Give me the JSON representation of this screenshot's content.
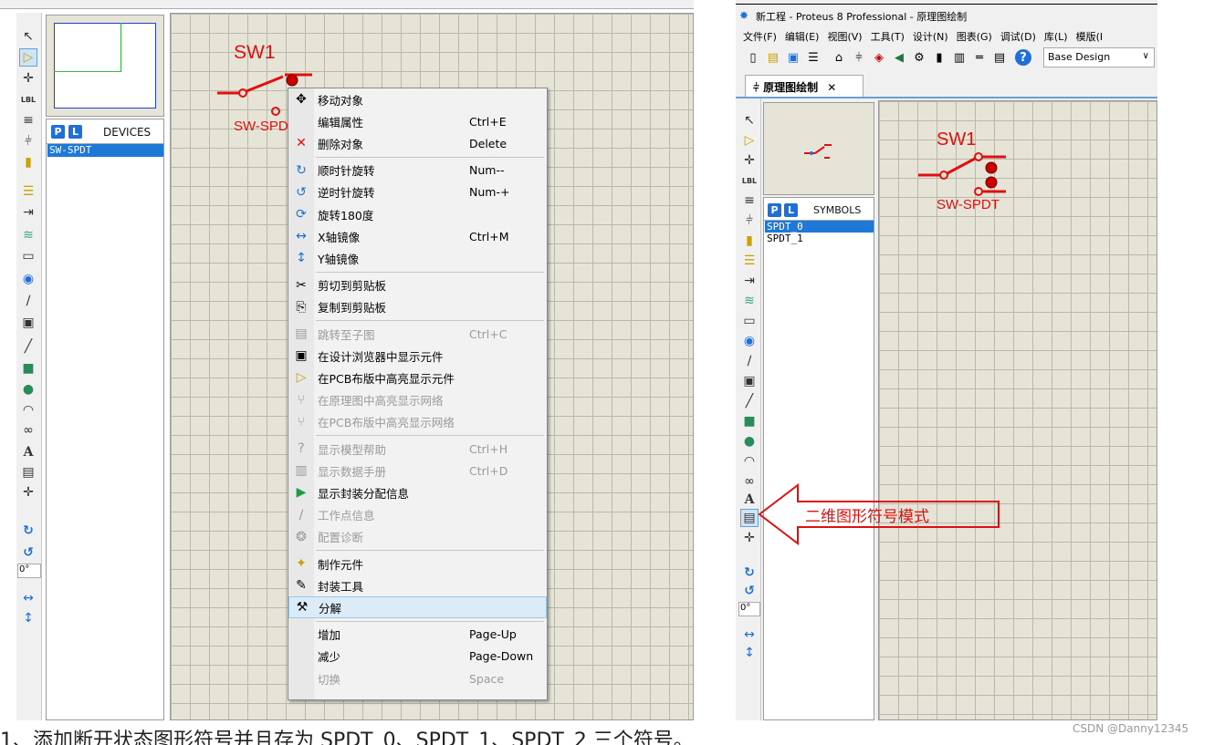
{
  "left": {
    "panel_header": "DEVICES",
    "device_selected": "SW-SPDT",
    "rotation_field": "0°",
    "component_label": "SW1",
    "component_ref": "SW-SPDT"
  },
  "context_menu": {
    "items": [
      {
        "label": "移动对象",
        "shortcut": "",
        "icon": "move-icon"
      },
      {
        "label": "编辑属性",
        "shortcut": "Ctrl+E",
        "icon": ""
      },
      {
        "label": "删除对象",
        "shortcut": "Delete",
        "icon": "delete-icon"
      },
      {
        "label": "顺时针旋转",
        "shortcut": "Num--",
        "icon": "rotate-cw-icon"
      },
      {
        "label": "逆时针旋转",
        "shortcut": "Num-+",
        "icon": "rotate-ccw-icon"
      },
      {
        "label": "旋转180度",
        "shortcut": "",
        "icon": "rotate-180-icon"
      },
      {
        "label": "X轴镜像",
        "shortcut": "Ctrl+M",
        "icon": "mirror-x-icon"
      },
      {
        "label": "Y轴镜像",
        "shortcut": "",
        "icon": "mirror-y-icon"
      },
      {
        "label": "剪切到剪贴板",
        "shortcut": "",
        "icon": "cut-icon"
      },
      {
        "label": "复制到剪贴板",
        "shortcut": "",
        "icon": "copy-icon"
      },
      {
        "label": "跳转至子图",
        "shortcut": "Ctrl+C",
        "icon": "subsheet-icon",
        "disabled": true
      },
      {
        "label": "在设计浏览器中显示元件",
        "shortcut": "",
        "icon": "browser-icon"
      },
      {
        "label": "在PCB布版中高亮显示元件",
        "shortcut": "",
        "icon": "pcb-highlight-icon"
      },
      {
        "label": "在原理图中高亮显示网络",
        "shortcut": "",
        "icon": "net-icon",
        "disabled": true
      },
      {
        "label": "在PCB布版中高亮显示网络",
        "shortcut": "",
        "icon": "pcb-net-icon",
        "disabled": true
      },
      {
        "label": "显示模型帮助",
        "shortcut": "Ctrl+H",
        "icon": "help-icon",
        "disabled": true
      },
      {
        "label": "显示数据手册",
        "shortcut": "Ctrl+D",
        "icon": "datasheet-icon",
        "disabled": true
      },
      {
        "label": "显示封装分配信息",
        "shortcut": "",
        "icon": "package-icon"
      },
      {
        "label": "工作点信息",
        "shortcut": "",
        "icon": "probe-icon",
        "disabled": true
      },
      {
        "label": "配置诊断",
        "shortcut": "",
        "icon": "diagnostic-icon",
        "disabled": true
      },
      {
        "label": "制作元件",
        "shortcut": "",
        "icon": "make-device-icon"
      },
      {
        "label": "封装工具",
        "shortcut": "",
        "icon": "package-tool-icon"
      },
      {
        "label": "分解",
        "shortcut": "",
        "icon": "decompose-icon",
        "highlighted": true
      },
      {
        "label": "增加",
        "shortcut": "Page-Up",
        "icon": ""
      },
      {
        "label": "减少",
        "shortcut": "Page-Down",
        "icon": ""
      },
      {
        "label": "切换",
        "shortcut": "Space",
        "icon": "",
        "disabled": true
      }
    ]
  },
  "right": {
    "window_title": "新工程 - Proteus 8 Professional - 原理图绘制",
    "menubar": [
      "文件(F)",
      "编辑(E)",
      "视图(V)",
      "工具(T)",
      "设计(N)",
      "图表(G)",
      "调试(D)",
      "库(L)",
      "模版(I"
    ],
    "design_dropdown": "Base Design",
    "tab_label": "原理图绘制",
    "panel_header": "SYMBOLS",
    "symbols": [
      "SPDT_0",
      "SPDT_1"
    ],
    "rotation_field": "0°",
    "component_label": "SW1",
    "component_ref": "SW-SPDT",
    "annotation": "二维图形符号模式"
  },
  "footer": {
    "caption": "1、添加断开状态图形符号并且存为 SPDT_0、SPDT_1、SPDT_2 三个符号。",
    "watermark": "CSDN @Danny12345"
  },
  "colors": {
    "grid_bg": "#e6e4d6",
    "accent_blue": "#1e78d8",
    "component_red": "#e01010"
  }
}
